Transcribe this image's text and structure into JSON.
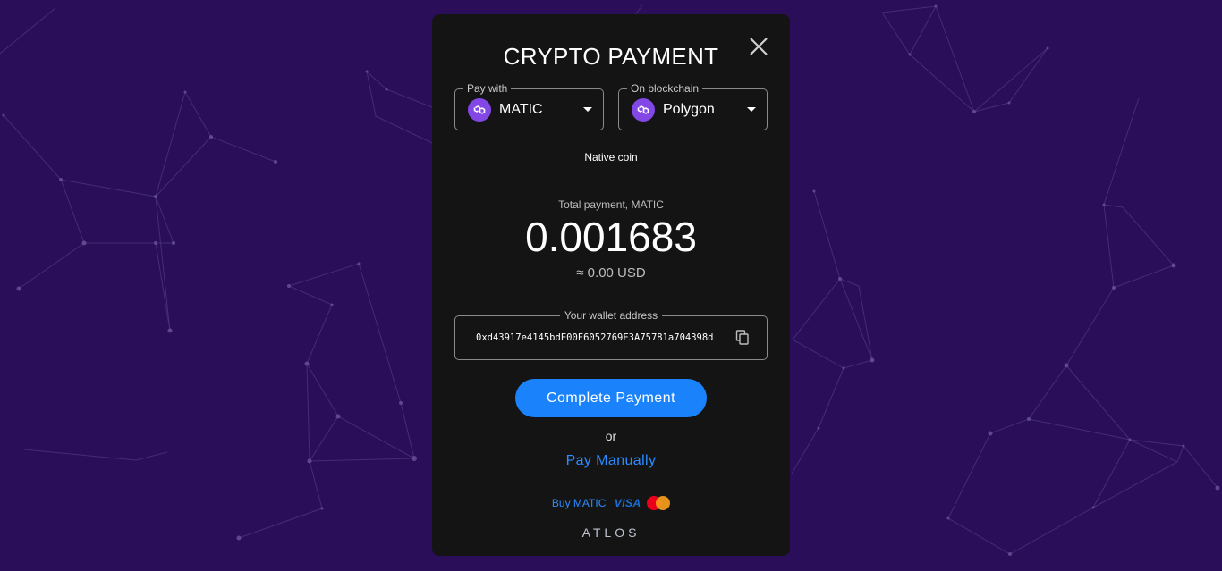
{
  "modal": {
    "title": "CRYPTO PAYMENT",
    "pay_with": {
      "label": "Pay with",
      "value": "MATIC",
      "icon": "polygon-coin-icon"
    },
    "blockchain": {
      "label": "On blockchain",
      "value": "Polygon",
      "icon": "polygon-coin-icon"
    },
    "coin_type": "Native coin",
    "total": {
      "label": "Total payment, MATIC",
      "amount": "0.001683",
      "usd": "≈ 0.00 USD"
    },
    "wallet": {
      "label": "Your wallet address",
      "address": "0xd43917e4145bdE00F6052769E3A75781a704398d"
    },
    "complete_button": "Complete Payment",
    "or_text": "or",
    "pay_manually": "Pay Manually",
    "buy_link": "Buy MATIC",
    "visa_text": "VISA",
    "brand": "ATLOS"
  },
  "colors": {
    "background": "#2a0e5a",
    "modal": "#141414",
    "accent": "#1a82fb",
    "coin": "#8247e5"
  }
}
